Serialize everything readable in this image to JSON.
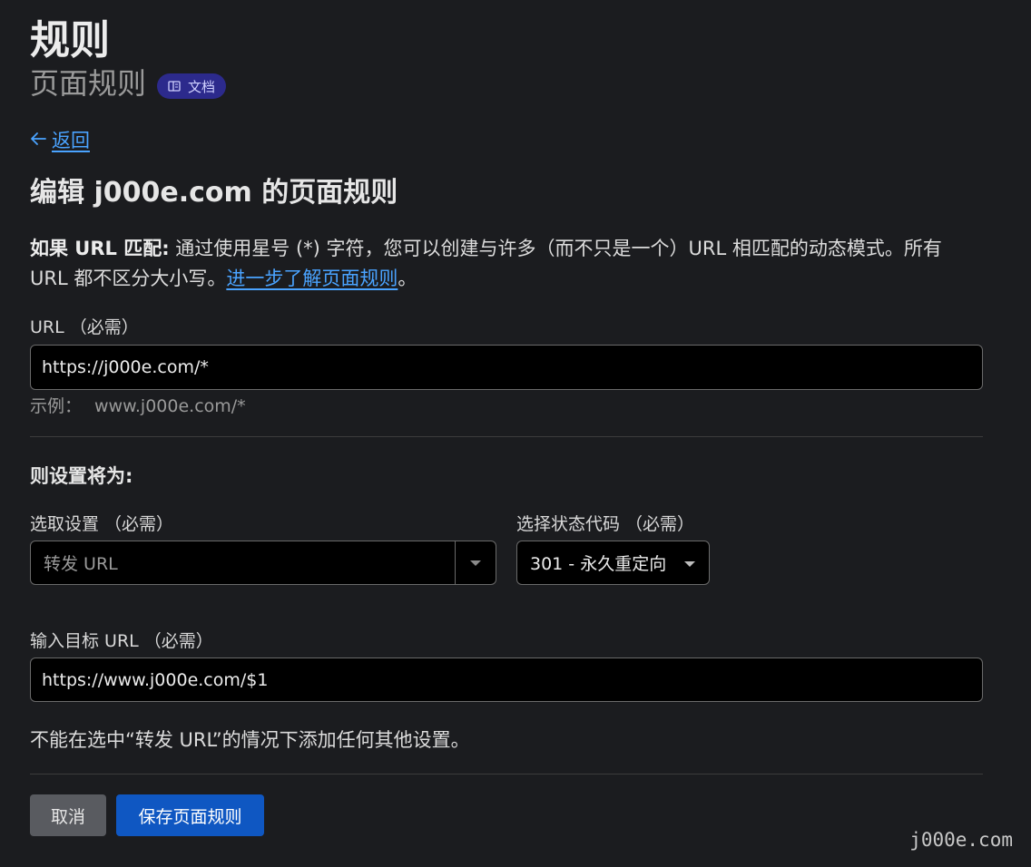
{
  "header": {
    "title": "规则",
    "subtitle": "页面规则",
    "doc_badge": "文档"
  },
  "nav": {
    "back_label": "返回"
  },
  "editor": {
    "heading": "编辑 j000e.com 的页面规则",
    "desc_strong": "如果 URL 匹配:",
    "desc_text": " 通过使用星号 (*) 字符，您可以创建与许多（而不只是一个）URL 相匹配的动态模式。所有 URL 都不区分大小写。",
    "desc_link": "进一步了解页面规则",
    "desc_end": "。"
  },
  "url_field": {
    "label": "URL （必需）",
    "value": "https://j000e.com/*",
    "example_label": "示例：",
    "example_value": "www.j000e.com/*"
  },
  "settings": {
    "heading": "则设置将为:",
    "setting_label": "选取设置 （必需）",
    "setting_value": "转发 URL",
    "status_label": "选择状态代码 （必需）",
    "status_value": "301 - 永久重定向",
    "target_label": "输入目标 URL （必需）",
    "target_value": "https://www.j000e.com/$1",
    "note": "不能在选中“转发 URL”的情况下添加任何其他设置。"
  },
  "actions": {
    "cancel_label": "取消",
    "save_label": "保存页面规则"
  },
  "watermark": "j000e.com",
  "colors": {
    "background": "#1b1c1f",
    "link": "#4aa3ff",
    "badge_bg": "#2c2a8c",
    "save_button": "#0f57c2",
    "cancel_button": "#595b60"
  }
}
